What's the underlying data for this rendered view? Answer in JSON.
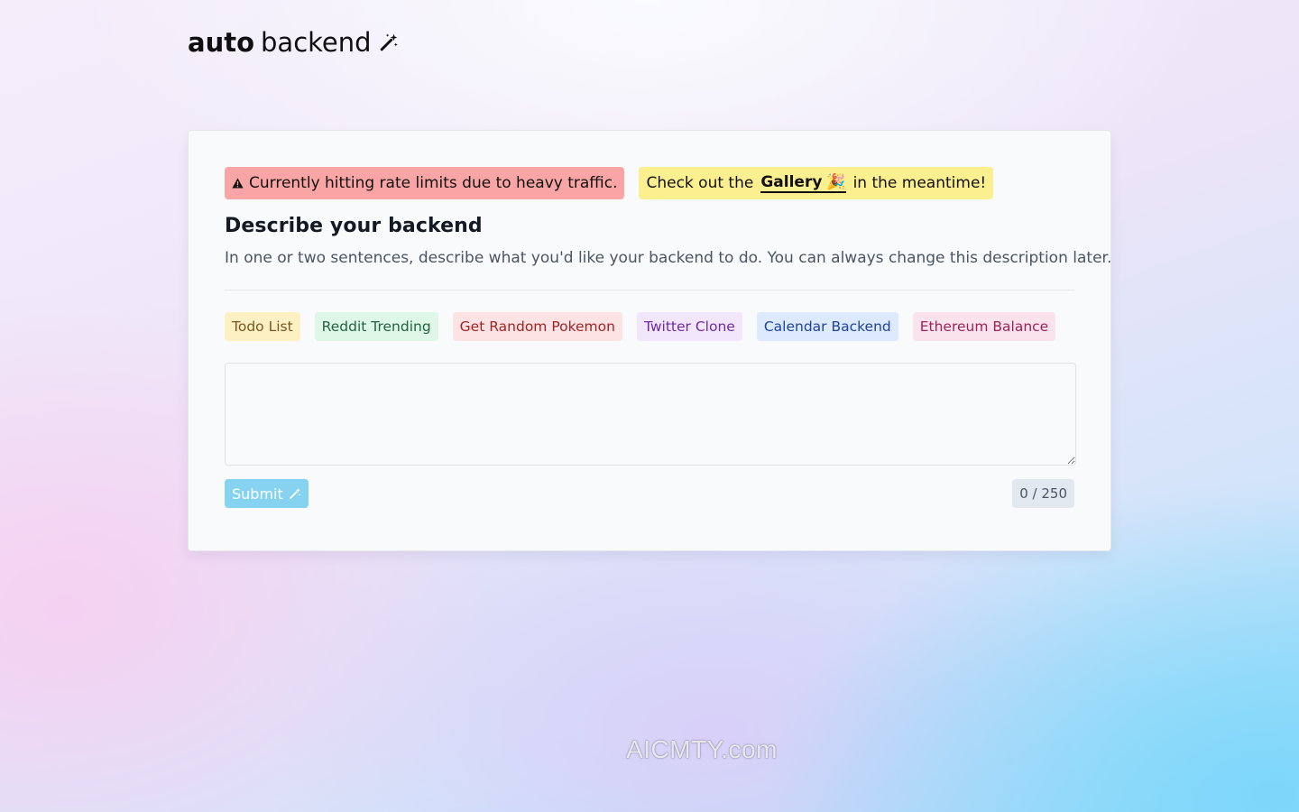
{
  "header": {
    "logo_bold": "auto",
    "logo_regular": "backend",
    "logo_icon": "magic-wand-icon"
  },
  "banners": {
    "warning_icon": "warning-triangle-icon",
    "warning_text": "Currently hitting rate limits due to heavy traffic.",
    "info_prefix": "Check out the",
    "gallery_label": "Gallery",
    "gallery_icon": "🎉",
    "info_suffix": "in the meantime!"
  },
  "form": {
    "heading": "Describe your backend",
    "subtext": "In one or two sentences, describe what you'd like your backend to do. You can always change this description later.",
    "examples": [
      {
        "label": "Todo List",
        "color": "#fdf1c4"
      },
      {
        "label": "Reddit Trending",
        "color": "#def7e7"
      },
      {
        "label": "Get Random Pokemon",
        "color": "#fde3e3"
      },
      {
        "label": "Twitter Clone",
        "color": "#f2e6fc"
      },
      {
        "label": "Calendar Backend",
        "color": "#dde9fc"
      },
      {
        "label": "Ethereum Balance",
        "color": "#fbe3ee"
      }
    ],
    "description_value": "",
    "description_placeholder": "",
    "submit_label": "Submit",
    "submit_icon": "magic-wand-icon",
    "submit_color": "#86d3f1",
    "char_counter": "0 / 250"
  },
  "watermark": "AICMTY.com"
}
